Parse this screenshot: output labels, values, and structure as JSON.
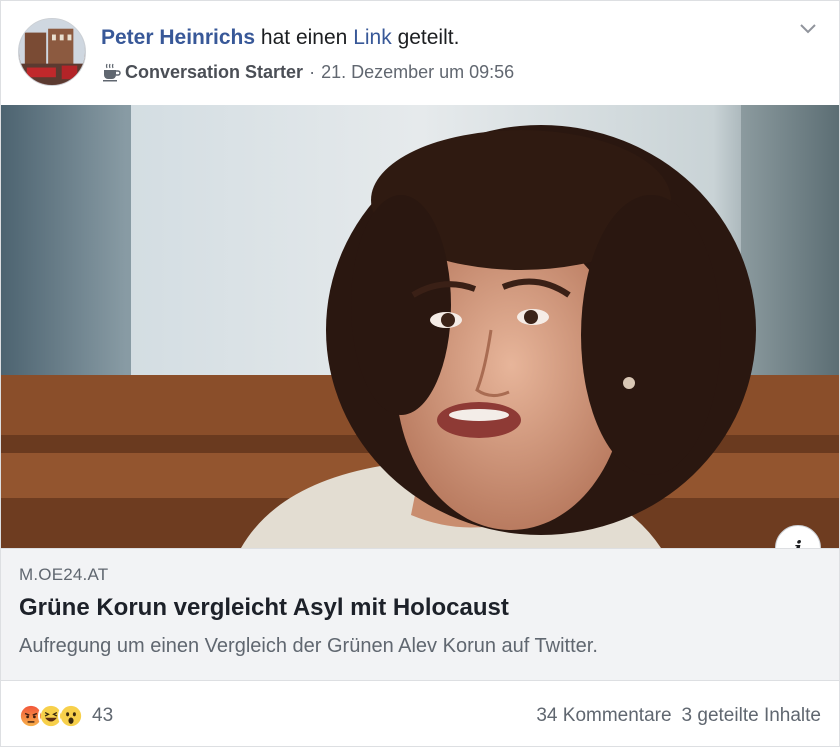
{
  "post": {
    "author": "Peter Heinrichs",
    "action_prefix": "hat einen",
    "action_link": "Link",
    "action_suffix": "geteilt.",
    "badge_icon": "coffee-cup-icon",
    "badge": "Conversation Starter",
    "separator": "·",
    "timestamp": "21. Dezember um 09:56"
  },
  "link_preview": {
    "domain": "M.OE24.AT",
    "headline": "Grüne Korun vergleicht Asyl mit Holocaust",
    "description": "Aufregung um einen Vergleich der Grünen Alev Korun auf Twitter.",
    "info_label": "i"
  },
  "footer": {
    "reaction_icons": [
      "angry-reaction-icon",
      "haha-reaction-icon",
      "wow-reaction-icon"
    ],
    "reaction_count": "43",
    "comments": "34 Kommentare",
    "shares": "3 geteilte Inhalte"
  },
  "colors": {
    "link_blue": "#385898",
    "muted_text": "#606770",
    "preview_bg": "#f2f3f5"
  }
}
